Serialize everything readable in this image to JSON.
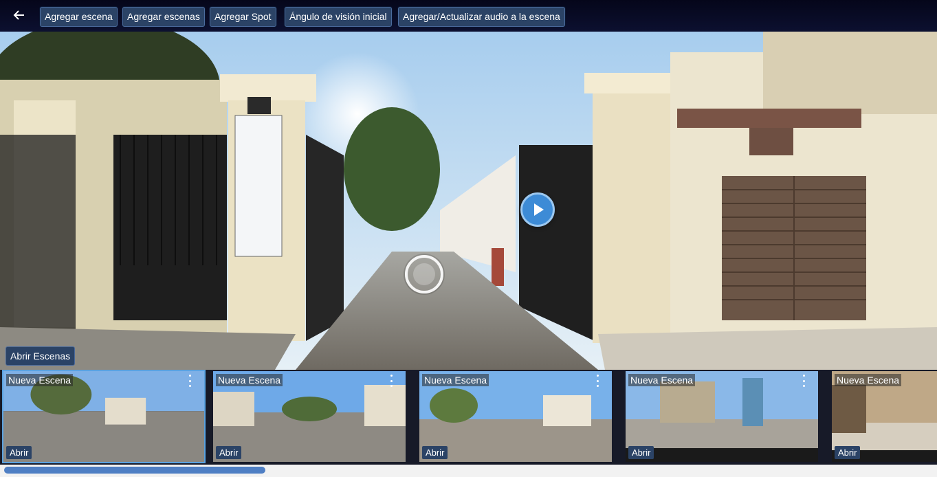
{
  "toolbar": {
    "back_label": "←",
    "buttons": [
      "Agregar escena",
      "Agregar escenas",
      "Agregar Spot",
      "Ángulo de visión inicial",
      "Agregar/Actualizar audio a la escena"
    ]
  },
  "viewer": {
    "open_scenes_label": "Abrir Escenas"
  },
  "scenes": [
    {
      "title": "Nueva Escena",
      "open_label": "Abrir",
      "active": true
    },
    {
      "title": "Nueva Escena",
      "open_label": "Abrir",
      "active": false
    },
    {
      "title": "Nueva Escena",
      "open_label": "Abrir",
      "active": false
    },
    {
      "title": "Nueva Escena",
      "open_label": "Abrir",
      "active": false
    },
    {
      "title": "Nueva Escena",
      "open_label": "Abrir",
      "active": false
    }
  ],
  "colors": {
    "button_bg": "#2b4366",
    "accent": "#5aa2e0"
  },
  "scrollbar": {
    "position_fraction": 0.0,
    "visible_fraction": 0.28
  }
}
